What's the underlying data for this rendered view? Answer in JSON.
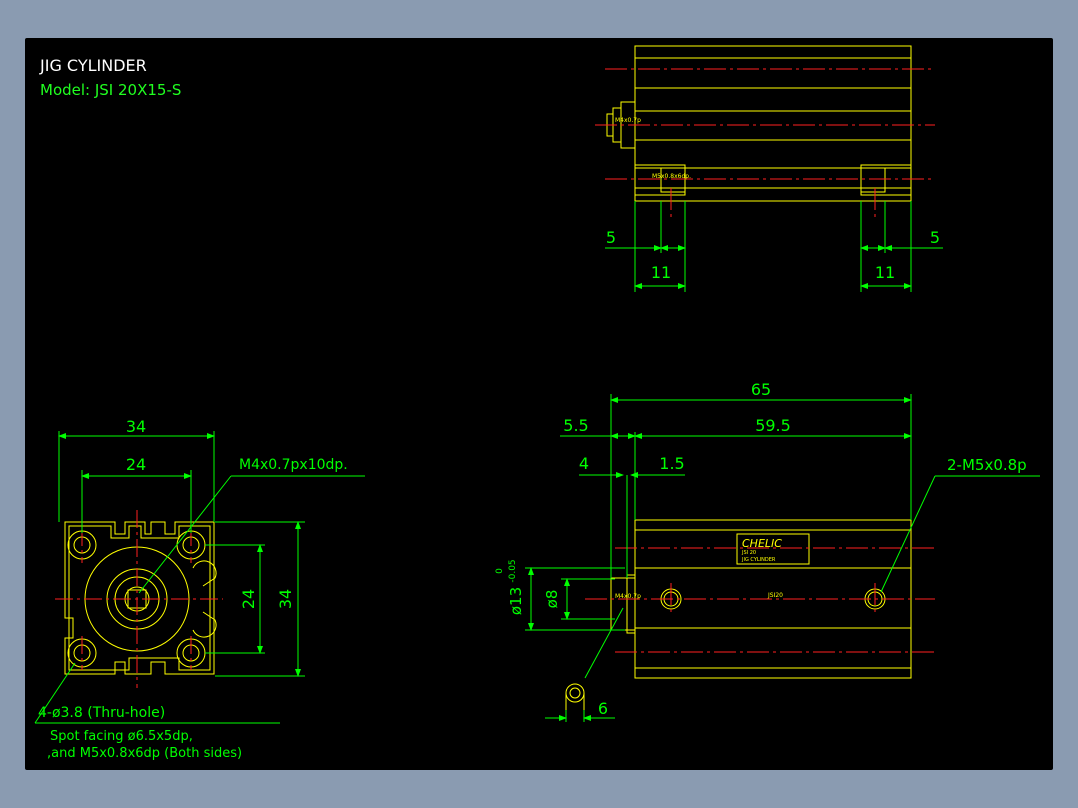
{
  "window": {
    "background": "#8a9bb1",
    "canvas_background": "#000000"
  },
  "colors": {
    "outline": "#ffff00",
    "dimension": "#00ff00",
    "center": "#ff2020",
    "title_white": "#ffffff",
    "model_green": "#20ff20"
  },
  "title": {
    "name": "JIG CYLINDER",
    "model": "Model:  JSI 20X15-S"
  },
  "top_view": {
    "dims": {
      "left_small": "5",
      "right_small": "5",
      "left_big": "11",
      "right_big": "11"
    },
    "labels": {
      "port": "M4x0.7p",
      "mount": "M5x0.8x6dp."
    }
  },
  "end_view": {
    "dims": {
      "outer_width": "34",
      "inner_width": "24",
      "inner_height": "24",
      "outer_height": "34"
    },
    "callout_thread": "M4x0.7px10dp.",
    "callout_holes": "4-ø3.8 (Thru-hole)",
    "note_line1": "Spot facing ø6.5x5dp,",
    "note_line2": ",and M5x0.8x6dp (Both sides)"
  },
  "side_view": {
    "dims": {
      "overall": "65",
      "body": "59.5",
      "front": "5.5",
      "rod_len": "4",
      "step": "1.5",
      "rod_tip": "6",
      "rod_dia": "ø8",
      "boss_dia": "ø13",
      "tol_upper": "0",
      "tol_lower": "-0.05"
    },
    "callout_mount": "2-M5x0.8p",
    "brand": "CHELIC",
    "plate_line1": "JSI 20",
    "plate_line2": "JIG CYLINDER",
    "body_label": "JSI20",
    "port_label": "M4x0.7p"
  }
}
